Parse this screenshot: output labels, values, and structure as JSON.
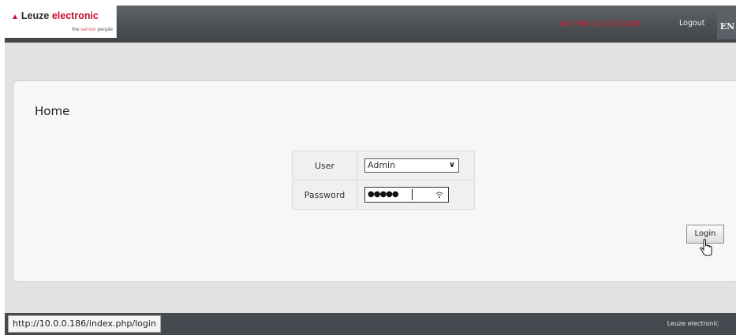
{
  "header": {
    "logo": {
      "brand": "Leuze",
      "brand_suffix": "electronic",
      "tagline_prefix": "the",
      "tagline_highlight": "sensor",
      "tagline_suffix": "people"
    },
    "status_text": "WD 7486 11-02/15/2028",
    "logout_label": "Logout",
    "language": "EN"
  },
  "main": {
    "title": "Home",
    "login_form": {
      "user_label": "User",
      "user_value": "Admin",
      "password_label": "Password",
      "password_mask": "●●●●●",
      "submit_label": "Login"
    }
  },
  "footer": {
    "status_url": "http://10.0.0.186/index.php/login",
    "brand": "Leuze electronic"
  },
  "colors": {
    "brand_red": "#c8102e",
    "header_bg": "#4b5054",
    "content_bg": "#e2e2e2",
    "panel_bg": "#f7f7f7"
  }
}
